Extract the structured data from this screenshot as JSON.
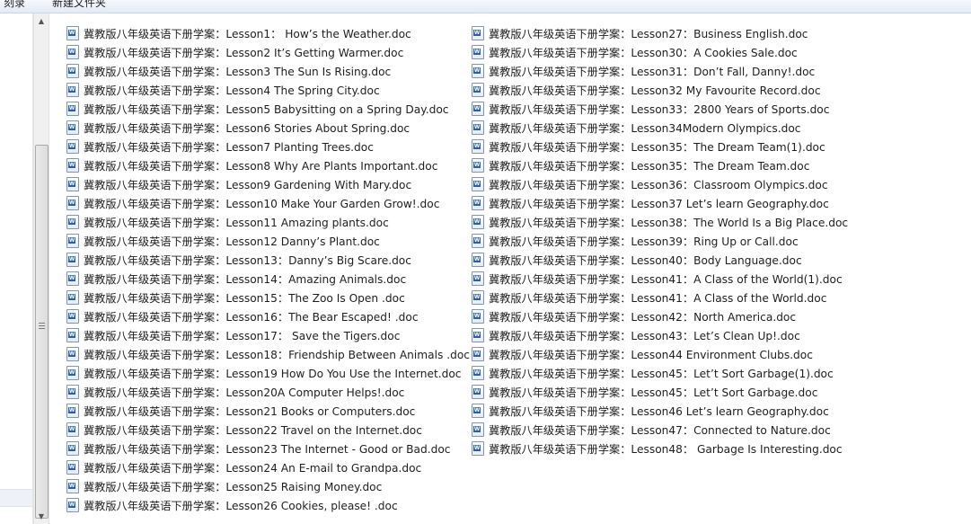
{
  "toolbar": {
    "burn_label": "刻录",
    "new_folder_label": "新建文件夹"
  },
  "icon": "word-document-icon",
  "files_left": [
    "冀教版八年级英语下册学案：Lesson1： How’s the Weather.doc",
    "冀教版八年级英语下册学案：Lesson2 It’s Getting Warmer.doc",
    "冀教版八年级英语下册学案：Lesson3 The Sun Is Rising.doc",
    "冀教版八年级英语下册学案：Lesson4 The Spring City.doc",
    "冀教版八年级英语下册学案：Lesson5 Babysitting on a Spring Day.doc",
    "冀教版八年级英语下册学案：Lesson6 Stories About Spring.doc",
    "冀教版八年级英语下册学案：Lesson7 Planting Trees.doc",
    "冀教版八年级英语下册学案：Lesson8 Why Are Plants Important.doc",
    "冀教版八年级英语下册学案：Lesson9 Gardening With Mary.doc",
    "冀教版八年级英语下册学案：Lesson10 Make Your Garden Grow!.doc",
    "冀教版八年级英语下册学案：Lesson11 Amazing plants.doc",
    "冀教版八年级英语下册学案：Lesson12 Danny’s Plant.doc",
    "冀教版八年级英语下册学案：Lesson13：Danny’s Big Scare.doc",
    "冀教版八年级英语下册学案：Lesson14：Amazing Animals.doc",
    "冀教版八年级英语下册学案：Lesson15：The Zoo Is Open .doc",
    "冀教版八年级英语下册学案：Lesson16：The Bear Escaped! .doc",
    "冀教版八年级英语下册学案：Lesson17： Save the Tigers.doc",
    "冀教版八年级英语下册学案：Lesson18：Friendship Between Animals .doc",
    "冀教版八年级英语下册学案：Lesson19 How Do You Use the Internet.doc",
    "冀教版八年级英语下册学案：Lesson20A Computer Helps!.doc",
    "冀教版八年级英语下册学案：Lesson21 Books or Computers.doc",
    "冀教版八年级英语下册学案：Lesson22 Travel on the Internet.doc",
    "冀教版八年级英语下册学案：Lesson23 The Internet - Good or Bad.doc",
    "冀教版八年级英语下册学案：Lesson24 An E-mail to Grandpa.doc",
    "冀教版八年级英语下册学案：Lesson25 Raising Money.doc",
    "冀教版八年级英语下册学案：Lesson26 Cookies, please! .doc"
  ],
  "files_right": [
    "冀教版八年级英语下册学案：Lesson27：Business English.doc",
    "冀教版八年级英语下册学案：Lesson30：A Cookies Sale.doc",
    "冀教版八年级英语下册学案：Lesson31：Don’t Fall, Danny!.doc",
    "冀教版八年级英语下册学案：Lesson32 My Favourite Record.doc",
    "冀教版八年级英语下册学案：Lesson33：2800 Years of Sports.doc",
    "冀教版八年级英语下册学案：Lesson34Modern Olympics.doc",
    "冀教版八年级英语下册学案：Lesson35：The Dream Team(1).doc",
    "冀教版八年级英语下册学案：Lesson35：The Dream Team.doc",
    "冀教版八年级英语下册学案：Lesson36：Classroom Olympics.doc",
    "冀教版八年级英语下册学案：Lesson37 Let’s learn Geography.doc",
    "冀教版八年级英语下册学案：Lesson38：The World Is a Big Place.doc",
    "冀教版八年级英语下册学案：Lesson39：Ring Up or Call.doc",
    "冀教版八年级英语下册学案：Lesson40：Body Language.doc",
    "冀教版八年级英语下册学案：Lesson41：A Class of the World(1).doc",
    "冀教版八年级英语下册学案：Lesson41：A Class of the World.doc",
    "冀教版八年级英语下册学案：Lesson42：North America.doc",
    "冀教版八年级英语下册学案：Lesson43：Let’s Clean Up!.doc",
    "冀教版八年级英语下册学案：Lesson44 Environment Clubs.doc",
    "冀教版八年级英语下册学案：Lesson45：Let’t Sort Garbage(1).doc",
    "冀教版八年级英语下册学案：Lesson45：Let’t Sort Garbage.doc",
    "冀教版八年级英语下册学案：Lesson46 Let’s learn Geography.doc",
    "冀教版八年级英语下册学案：Lesson47：Connected to Nature.doc",
    "冀教版八年级英语下册学案：Lesson48： Garbage Is Interesting.doc"
  ]
}
